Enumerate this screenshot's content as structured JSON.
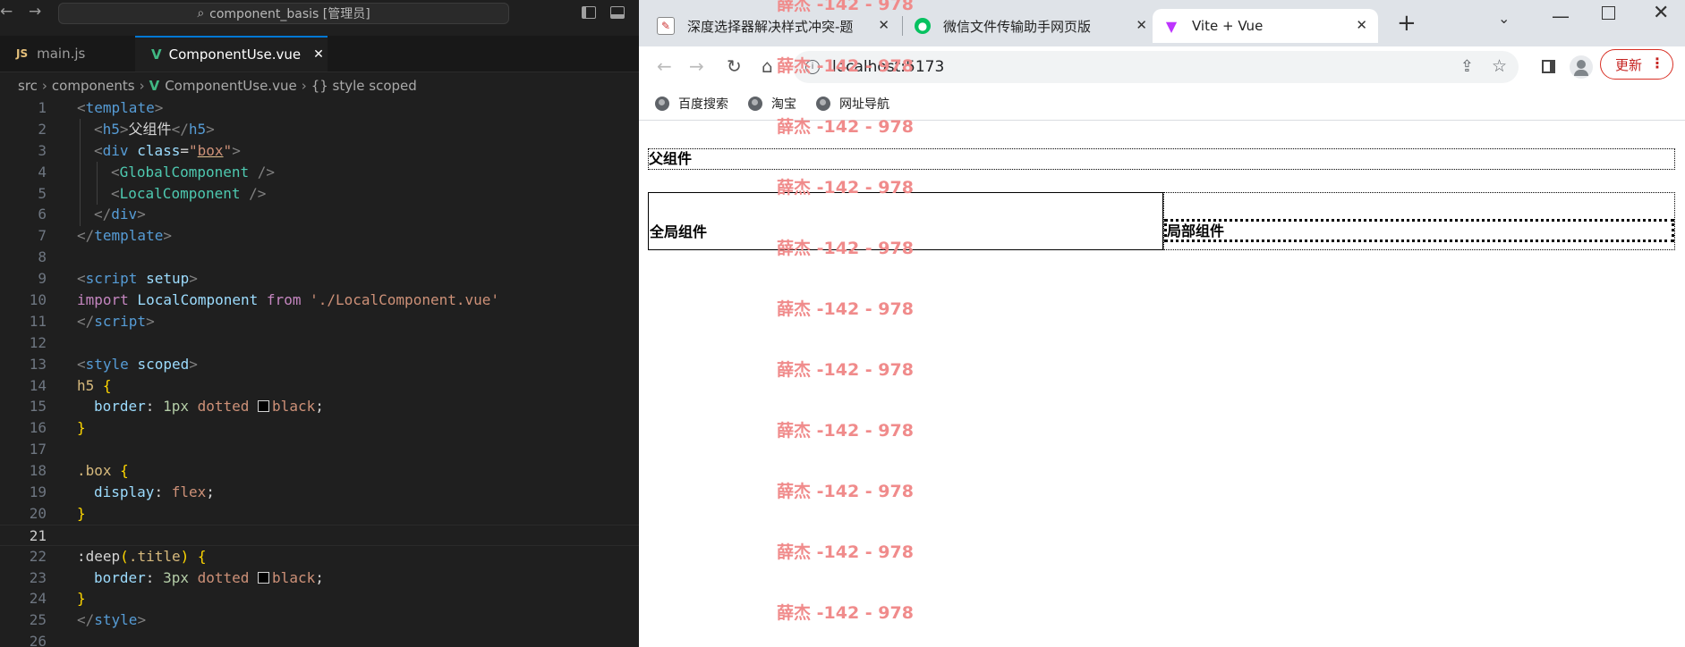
{
  "vscode": {
    "search_text": "component_basis [管理员]",
    "tabs": [
      {
        "icon": "JS",
        "label": "main.js"
      },
      {
        "icon": "V",
        "label": "ComponentUse.vue",
        "close": "✕"
      }
    ],
    "breadcrumb": [
      "src",
      "components",
      "ComponentUse.vue",
      "{} style scoped"
    ],
    "current_line": 21,
    "line_numbers": [
      "1",
      "2",
      "3",
      "4",
      "5",
      "6",
      "7",
      "8",
      "9",
      "10",
      "11",
      "12",
      "13",
      "14",
      "15",
      "16",
      "17",
      "18",
      "19",
      "20",
      "21",
      "22",
      "23",
      "24",
      "25",
      "26"
    ],
    "code": {
      "l1": {
        "a": "<",
        "b": "template",
        "c": ">"
      },
      "l2": {
        "a": "<",
        "b": "h5",
        "c": ">",
        "d": "父组件",
        "e": "</",
        "f": "h5",
        "g": ">"
      },
      "l3": {
        "a": "<",
        "b": "div",
        "c": " ",
        "d": "class",
        "e": "=",
        "f": "\"",
        "g": "box",
        "h": "\"",
        "i": ">"
      },
      "l4": {
        "a": "<",
        "b": "GlobalComponent",
        "c": " />"
      },
      "l5": {
        "a": "<",
        "b": "LocalComponent",
        "c": " />"
      },
      "l6": {
        "a": "</",
        "b": "div",
        "c": ">"
      },
      "l7": {
        "a": "</",
        "b": "template",
        "c": ">"
      },
      "l9": {
        "a": "<",
        "b": "script",
        "c": " ",
        "d": "setup",
        "e": ">"
      },
      "l10": {
        "a": "import",
        "b": " LocalComponent ",
        "c": "from",
        "d": " ",
        "e": "'./LocalComponent.vue'"
      },
      "l11": {
        "a": "</",
        "b": "script",
        "c": ">"
      },
      "l13": {
        "a": "<",
        "b": "style",
        "c": " ",
        "d": "scoped",
        "e": ">"
      },
      "l14": {
        "a": "h5",
        "b": " ",
        "c": "{"
      },
      "l15": {
        "a": "border",
        "b": ": ",
        "c": "1px",
        "d": " ",
        "e": "dotted",
        "f": " ",
        "g": "black",
        "h": ";"
      },
      "l16": {
        "a": "}"
      },
      "l18": {
        "a": ".box",
        "b": " ",
        "c": "{"
      },
      "l19": {
        "a": "display",
        "b": ": ",
        "c": "flex",
        "d": ";"
      },
      "l20": {
        "a": "}"
      },
      "l22": {
        "a": ":deep",
        "b": "(",
        "c": ".title",
        "d": ")",
        "e": " ",
        "f": "{"
      },
      "l23": {
        "a": "border",
        "b": ": ",
        "c": "3px",
        "d": " ",
        "e": "dotted",
        "f": " ",
        "g": "black",
        "h": ";"
      },
      "l24": {
        "a": "}"
      },
      "l25": {
        "a": "</",
        "b": "style",
        "c": ">"
      }
    }
  },
  "chrome": {
    "tabs": [
      {
        "label": "深度选择器解决样式冲突-题",
        "close": "✕"
      },
      {
        "label": "微信文件传输助手网页版",
        "close": "✕"
      },
      {
        "label": "Vite + Vue",
        "close": "✕"
      }
    ],
    "new_tab": "+",
    "url": "localhost:5173",
    "update_label": "更新",
    "bookmarks": [
      "百度搜索",
      "淘宝",
      "网址导航"
    ],
    "page": {
      "parent_title": "父组件",
      "global_component": "全局组件",
      "local_component": "局部组件"
    },
    "watermark": "薛杰 -142 - 978"
  },
  "colors": {
    "editor_bg": "#1f1f1f",
    "accent": "#0078d4",
    "watermark": "#f08b8b",
    "update_red": "#d93025"
  }
}
